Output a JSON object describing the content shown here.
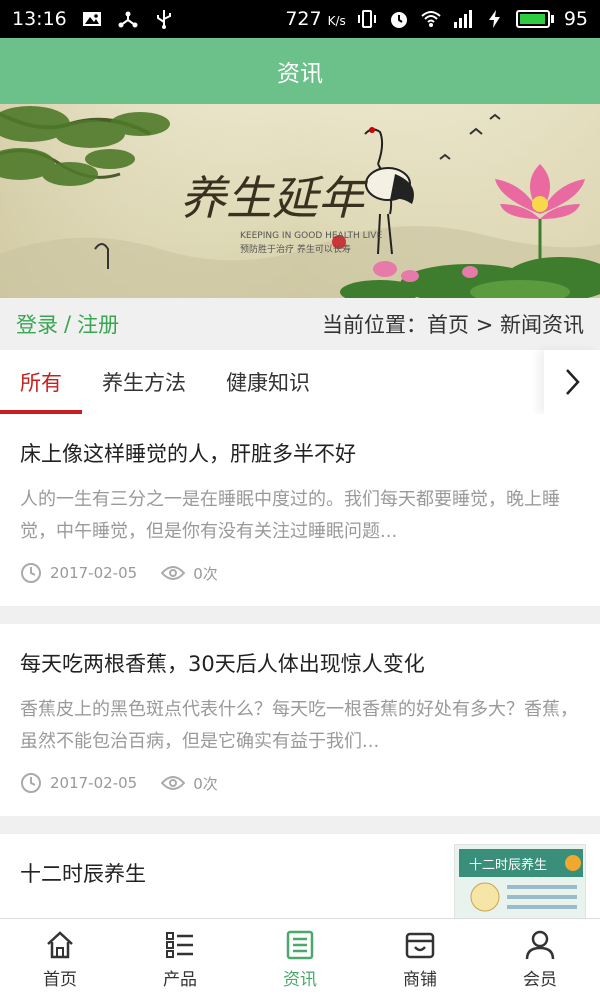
{
  "status_bar": {
    "time": "13:16",
    "speed": "727",
    "speed_unit": "K/s",
    "battery_level": "95",
    "battery_fraction": 0.95
  },
  "header": {
    "title": "资讯"
  },
  "banner": {
    "calligraphy": "养生延年",
    "subtitle_en": "KEEPING IN GOOD HEALTH LIVE",
    "subtitle_cn": "预防胜于治疗 养生可以长寿"
  },
  "location": {
    "login": "登录",
    "separator": "/",
    "register": "注册",
    "breadcrumb": "当前位置：首页 > 新闻资讯"
  },
  "tabs": [
    {
      "label": "所有",
      "active": true
    },
    {
      "label": "养生方法",
      "active": false
    },
    {
      "label": "健康知识",
      "active": false
    }
  ],
  "articles": [
    {
      "title": "床上像这样睡觉的人，肝脏多半不好",
      "summary": "人的一生有三分之一是在睡眠中度过的。我们每天都要睡觉，晚上睡觉，中午睡觉，但是你有没有关注过睡眠问题...",
      "date": "2017-02-05",
      "views": "0次"
    },
    {
      "title": "每天吃两根香蕉，30天后人体出现惊人变化",
      "summary": "香蕉皮上的黑色斑点代表什么？每天吃一根香蕉的好处有多大？香蕉，虽然不能包治百病，但是它确实有益于我们...",
      "date": "2017-02-05",
      "views": "0次"
    },
    {
      "title": "十二时辰养生",
      "thumb_text": "十二时辰养生"
    }
  ],
  "bottom_nav": [
    {
      "label": "首页",
      "icon": "home-icon",
      "active": false
    },
    {
      "label": "产品",
      "icon": "list-icon",
      "active": false
    },
    {
      "label": "资讯",
      "icon": "news-icon",
      "active": true
    },
    {
      "label": "商铺",
      "icon": "shop-icon",
      "active": false
    },
    {
      "label": "会员",
      "icon": "user-icon",
      "active": false
    }
  ],
  "colors": {
    "header_green": "#6cc08a",
    "tab_active_red": "#c81e1e",
    "login_green": "#39a651",
    "nav_active_green": "#4aa868"
  }
}
